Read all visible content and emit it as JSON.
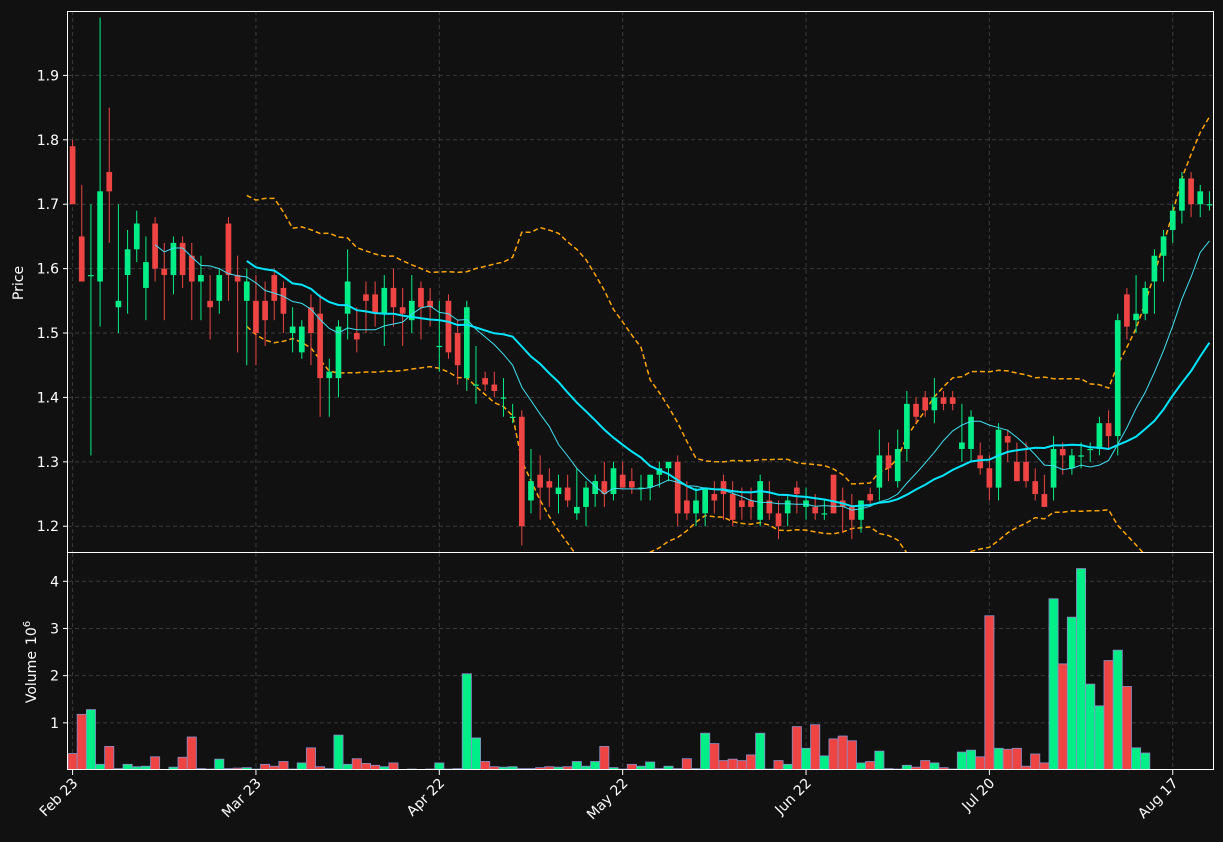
{
  "chart_data": {
    "type": "candlestick",
    "price_panel": {
      "ylabel": "Price",
      "ylim": [
        1.16,
        2.0
      ],
      "yticks": [
        1.2,
        1.3,
        1.4,
        1.5,
        1.6,
        1.7,
        1.8,
        1.9
      ],
      "ytick_labels": [
        "1.2",
        "1.3",
        "1.4",
        "1.5",
        "1.6",
        "1.7",
        "1.8",
        "1.9"
      ],
      "grid": true
    },
    "volume_panel": {
      "ylabel": "Volume",
      "ylabel_exponent": "10",
      "ylabel_power": "6",
      "ylim": [
        0,
        4.6
      ],
      "yticks": [
        1,
        2,
        3,
        4
      ],
      "ytick_labels": [
        "1",
        "2",
        "3",
        "4"
      ],
      "grid": true
    },
    "x_tick_indices": [
      0,
      20,
      40,
      60,
      80,
      100,
      120
    ],
    "x_tick_labels": [
      "Feb 23",
      "Mar 23",
      "Apr 22",
      "May 22",
      "Jun 22",
      "Jul 20",
      "Aug 17"
    ],
    "ohlc": [
      [
        1.79,
        1.8,
        1.7,
        1.7
      ],
      [
        1.65,
        1.73,
        1.58,
        1.58
      ],
      [
        1.59,
        1.7,
        1.31,
        1.59
      ],
      [
        1.58,
        1.99,
        1.51,
        1.72
      ],
      [
        1.75,
        1.85,
        1.64,
        1.72
      ],
      [
        1.54,
        1.7,
        1.5,
        1.55
      ],
      [
        1.59,
        1.66,
        1.53,
        1.63
      ],
      [
        1.63,
        1.69,
        1.61,
        1.67
      ],
      [
        1.57,
        1.65,
        1.52,
        1.61
      ],
      [
        1.67,
        1.68,
        1.58,
        1.6
      ],
      [
        1.6,
        1.64,
        1.52,
        1.59
      ],
      [
        1.59,
        1.65,
        1.56,
        1.64
      ],
      [
        1.64,
        1.65,
        1.57,
        1.59
      ],
      [
        1.62,
        1.64,
        1.52,
        1.58
      ],
      [
        1.58,
        1.62,
        1.52,
        1.59
      ],
      [
        1.55,
        1.59,
        1.49,
        1.54
      ],
      [
        1.55,
        1.6,
        1.53,
        1.59
      ],
      [
        1.67,
        1.68,
        1.55,
        1.59
      ],
      [
        1.59,
        1.62,
        1.47,
        1.58
      ],
      [
        1.55,
        1.6,
        1.45,
        1.58
      ],
      [
        1.55,
        1.59,
        1.45,
        1.5
      ],
      [
        1.55,
        1.58,
        1.48,
        1.52
      ],
      [
        1.59,
        1.6,
        1.52,
        1.55
      ],
      [
        1.57,
        1.58,
        1.5,
        1.53
      ],
      [
        1.5,
        1.54,
        1.47,
        1.51
      ],
      [
        1.47,
        1.52,
        1.46,
        1.51
      ],
      [
        1.54,
        1.56,
        1.45,
        1.5
      ],
      [
        1.53,
        1.56,
        1.37,
        1.43
      ],
      [
        1.43,
        1.46,
        1.37,
        1.44
      ],
      [
        1.43,
        1.52,
        1.4,
        1.51
      ],
      [
        1.53,
        1.63,
        1.49,
        1.58
      ],
      [
        1.5,
        1.54,
        1.47,
        1.49
      ],
      [
        1.56,
        1.58,
        1.5,
        1.55
      ],
      [
        1.56,
        1.58,
        1.51,
        1.53
      ],
      [
        1.53,
        1.59,
        1.48,
        1.57
      ],
      [
        1.57,
        1.6,
        1.51,
        1.54
      ],
      [
        1.54,
        1.57,
        1.48,
        1.53
      ],
      [
        1.52,
        1.59,
        1.5,
        1.55
      ],
      [
        1.57,
        1.58,
        1.49,
        1.54
      ],
      [
        1.55,
        1.57,
        1.51,
        1.54
      ],
      [
        1.48,
        1.55,
        1.44,
        1.48
      ],
      [
        1.55,
        1.56,
        1.46,
        1.47
      ],
      [
        1.5,
        1.52,
        1.42,
        1.45
      ],
      [
        1.43,
        1.55,
        1.41,
        1.54
      ],
      [
        1.42,
        1.48,
        1.39,
        1.42
      ],
      [
        1.43,
        1.44,
        1.41,
        1.42
      ],
      [
        1.42,
        1.44,
        1.4,
        1.41
      ],
      [
        1.4,
        1.43,
        1.37,
        1.4
      ],
      [
        1.37,
        1.39,
        1.36,
        1.37
      ],
      [
        1.37,
        1.38,
        1.17,
        1.2
      ],
      [
        1.24,
        1.32,
        1.22,
        1.27
      ],
      [
        1.28,
        1.31,
        1.21,
        1.26
      ],
      [
        1.27,
        1.29,
        1.23,
        1.26
      ],
      [
        1.25,
        1.28,
        1.22,
        1.26
      ],
      [
        1.26,
        1.28,
        1.23,
        1.24
      ],
      [
        1.22,
        1.29,
        1.21,
        1.23
      ],
      [
        1.23,
        1.27,
        1.2,
        1.26
      ],
      [
        1.25,
        1.28,
        1.23,
        1.27
      ],
      [
        1.27,
        1.3,
        1.23,
        1.25
      ],
      [
        1.25,
        1.3,
        1.24,
        1.29
      ],
      [
        1.28,
        1.3,
        1.26,
        1.26
      ],
      [
        1.27,
        1.29,
        1.25,
        1.26
      ],
      [
        1.26,
        1.28,
        1.24,
        1.26
      ],
      [
        1.26,
        1.28,
        1.24,
        1.28
      ],
      [
        1.28,
        1.3,
        1.26,
        1.29
      ],
      [
        1.29,
        1.3,
        1.27,
        1.3
      ],
      [
        1.3,
        1.31,
        1.2,
        1.22
      ],
      [
        1.24,
        1.27,
        1.21,
        1.22
      ],
      [
        1.22,
        1.26,
        1.2,
        1.24
      ],
      [
        1.22,
        1.26,
        1.2,
        1.26
      ],
      [
        1.25,
        1.27,
        1.22,
        1.24
      ],
      [
        1.27,
        1.28,
        1.21,
        1.25
      ],
      [
        1.25,
        1.27,
        1.2,
        1.21
      ],
      [
        1.24,
        1.26,
        1.21,
        1.23
      ],
      [
        1.24,
        1.26,
        1.21,
        1.23
      ],
      [
        1.21,
        1.28,
        1.2,
        1.27
      ],
      [
        1.24,
        1.27,
        1.21,
        1.22
      ],
      [
        1.22,
        1.24,
        1.18,
        1.2
      ],
      [
        1.22,
        1.25,
        1.2,
        1.24
      ],
      [
        1.26,
        1.27,
        1.22,
        1.25
      ],
      [
        1.23,
        1.26,
        1.21,
        1.24
      ],
      [
        1.23,
        1.25,
        1.21,
        1.22
      ],
      [
        1.22,
        1.24,
        1.21,
        1.22
      ],
      [
        1.28,
        1.28,
        1.22,
        1.22
      ],
      [
        1.24,
        1.26,
        1.19,
        1.23
      ],
      [
        1.23,
        1.25,
        1.18,
        1.21
      ],
      [
        1.21,
        1.24,
        1.19,
        1.24
      ],
      [
        1.25,
        1.26,
        1.23,
        1.24
      ],
      [
        1.26,
        1.35,
        1.24,
        1.31
      ],
      [
        1.31,
        1.33,
        1.27,
        1.29
      ],
      [
        1.27,
        1.35,
        1.26,
        1.32
      ],
      [
        1.32,
        1.41,
        1.3,
        1.39
      ],
      [
        1.39,
        1.4,
        1.36,
        1.37
      ],
      [
        1.4,
        1.41,
        1.37,
        1.38
      ],
      [
        1.38,
        1.43,
        1.36,
        1.4
      ],
      [
        1.4,
        1.41,
        1.38,
        1.39
      ],
      [
        1.4,
        1.41,
        1.38,
        1.39
      ],
      [
        1.32,
        1.39,
        1.3,
        1.33
      ],
      [
        1.32,
        1.38,
        1.3,
        1.37
      ],
      [
        1.31,
        1.33,
        1.28,
        1.29
      ],
      [
        1.29,
        1.31,
        1.24,
        1.26
      ],
      [
        1.26,
        1.36,
        1.24,
        1.35
      ],
      [
        1.34,
        1.35,
        1.3,
        1.33
      ],
      [
        1.3,
        1.33,
        1.27,
        1.27
      ],
      [
        1.3,
        1.33,
        1.26,
        1.27
      ],
      [
        1.27,
        1.29,
        1.24,
        1.25
      ],
      [
        1.25,
        1.28,
        1.23,
        1.23
      ],
      [
        1.26,
        1.34,
        1.24,
        1.32
      ],
      [
        1.32,
        1.33,
        1.28,
        1.31
      ],
      [
        1.29,
        1.32,
        1.28,
        1.31
      ],
      [
        1.31,
        1.33,
        1.29,
        1.31
      ],
      [
        1.32,
        1.33,
        1.3,
        1.32
      ],
      [
        1.32,
        1.37,
        1.31,
        1.36
      ],
      [
        1.36,
        1.38,
        1.32,
        1.34
      ],
      [
        1.34,
        1.53,
        1.31,
        1.52
      ],
      [
        1.56,
        1.57,
        1.49,
        1.51
      ],
      [
        1.52,
        1.59,
        1.5,
        1.53
      ],
      [
        1.53,
        1.58,
        1.52,
        1.57
      ],
      [
        1.58,
        1.63,
        1.53,
        1.62
      ],
      [
        1.62,
        1.66,
        1.58,
        1.65
      ],
      [
        1.66,
        1.7,
        1.64,
        1.69
      ],
      [
        1.69,
        1.75,
        1.67,
        1.74
      ],
      [
        1.74,
        1.75,
        1.68,
        1.7
      ],
      [
        1.7,
        1.73,
        1.68,
        1.72
      ],
      [
        1.7,
        1.72,
        1.69,
        1.7
      ]
    ],
    "volume": [
      0.35,
      1.18,
      1.28,
      0.12,
      0.5,
      0.03,
      0.12,
      0.07,
      0.08,
      0.28,
      0.01,
      0.06,
      0.27,
      0.7,
      0.03,
      0.02,
      0.23,
      0.03,
      0.04,
      0.05,
      0.02,
      0.12,
      0.08,
      0.18,
      0.02,
      0.15,
      0.47,
      0.07,
      0.03,
      0.74,
      0.12,
      0.24,
      0.14,
      0.1,
      0.07,
      0.15,
      0.01,
      0.02,
      0.01,
      0.02,
      0.15,
      0.02,
      0.03,
      2.04,
      0.68,
      0.18,
      0.07,
      0.06,
      0.07,
      0.03,
      0.03,
      0.05,
      0.07,
      0.06,
      0.07,
      0.18,
      0.08,
      0.18,
      0.5,
      0.05,
      0.02,
      0.12,
      0.08,
      0.17,
      0.03,
      0.08,
      0.03,
      0.24,
      0.03,
      0.78,
      0.56,
      0.2,
      0.23,
      0.2,
      0.32,
      0.78,
      0.02,
      0.2,
      0.12,
      0.92,
      0.46,
      0.96,
      0.3,
      0.66,
      0.72,
      0.62,
      0.15,
      0.18,
      0.4,
      0.03,
      0.02,
      0.1,
      0.06,
      0.2,
      0.15,
      0.05,
      0.02,
      0.38,
      0.42,
      0.28,
      3.27,
      0.46,
      0.44,
      0.46,
      0.08,
      0.34,
      0.15,
      3.63,
      2.25,
      3.24,
      4.27,
      1.82,
      1.36,
      2.32,
      2.54,
      1.77,
      0.47,
      0.36
    ],
    "overlays": [
      {
        "kind": "sma_short",
        "color": "#40e0f0",
        "width": 1
      },
      {
        "kind": "sma_long",
        "color": "#00e5ff",
        "width": 2
      },
      {
        "kind": "band_upper",
        "color": "#ffa500",
        "width": 1.5,
        "dashed": true
      },
      {
        "kind": "band_lower",
        "color": "#ffa500",
        "width": 1.5,
        "dashed": true
      }
    ],
    "colors": {
      "up": "#00ee88",
      "down": "#ee4444",
      "edge": "#8a8fc6",
      "background": "#111111",
      "axes": "#ffffff",
      "grid": "#3a3a3a"
    }
  }
}
